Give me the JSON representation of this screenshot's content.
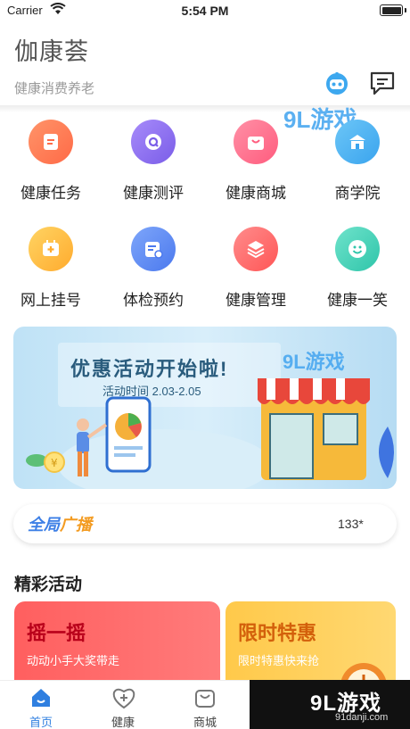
{
  "status": {
    "carrier": "Carrier",
    "time": "5:54 PM"
  },
  "header": {
    "title": "伽康荟",
    "subtitle": "健康消费养老"
  },
  "icons": {
    "robot": "robot-icon",
    "message": "message-icon"
  },
  "grid": [
    {
      "label": "健康任务",
      "color": "#ff7a55"
    },
    {
      "label": "健康测评",
      "color": "#8a6cf0"
    },
    {
      "label": "健康商城",
      "color": "#ff6f8a"
    },
    {
      "label": "商学院",
      "color": "#4ab0f0"
    },
    {
      "label": "网上挂号",
      "color": "#ffbf3a"
    },
    {
      "label": "体检预约",
      "color": "#5a8ef5"
    },
    {
      "label": "健康管理",
      "color": "#ff6a6a"
    },
    {
      "label": "健康一笑",
      "color": "#3fd0b6"
    }
  ],
  "banner": {
    "title": "优惠活动开始啦!",
    "subtitle": "活动时间 2.03-2.05"
  },
  "broadcast": {
    "logo_a": "全局",
    "logo_b": "广播",
    "count": "133*"
  },
  "section": {
    "title": "精彩活动"
  },
  "cards": [
    {
      "title": "摇一摇",
      "subtitle": "动动小手大奖带走"
    },
    {
      "title": "限时特惠",
      "subtitle": "限时特惠快来抢"
    }
  ],
  "tabs": [
    {
      "label": "首页",
      "active": true
    },
    {
      "label": "健康",
      "active": false
    },
    {
      "label": "商城",
      "active": false
    }
  ],
  "watermark": {
    "title": "9L游戏",
    "url": "91danji.com",
    "small": "9L游戏"
  }
}
